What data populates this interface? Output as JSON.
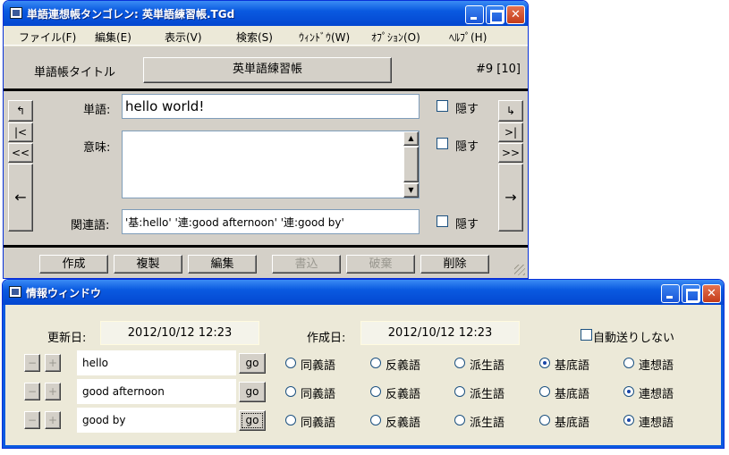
{
  "main_window": {
    "title": "単語連想帳タンゴレン: 英単語練習帳.TGd",
    "menu": [
      "ファイル(F)",
      "編集(E)",
      "表示(V)",
      "検索(S)",
      "ｳｨﾝﾄﾞｳ(W)",
      "ｵﾌﾟｼｮﾝ(O)",
      "ﾍﾙﾌﾟ(H)"
    ],
    "book_title_label": "単語帳タイトル",
    "book_title": "英単語練習帳",
    "counter": "#9 [10]",
    "word_label": "単語:",
    "word_value": "hello world!",
    "meaning_label": "意味:",
    "meaning_value": "",
    "related_label": "関連語:",
    "related_value": "'基:hello' '連:good afternoon' '連:good by'",
    "hide_label": "隠す",
    "nav_left": [
      "↰",
      "|<",
      "<<",
      "←"
    ],
    "nav_right": [
      "↳",
      ">|",
      ">>",
      "→"
    ],
    "buttons": [
      "作成",
      "複製",
      "編集",
      "書込",
      "破棄",
      "削除"
    ]
  },
  "info_window": {
    "title": "情報ウィンドウ",
    "updated_label": "更新日:",
    "updated_value": "2012/10/12 12:23",
    "created_label": "作成日:",
    "created_value": "2012/10/12 12:23",
    "auto_label": "自動送りしない",
    "go_label": "go",
    "minus": "−",
    "plus": "+",
    "radio_labels": [
      "同義語",
      "反義語",
      "派生語",
      "基底語",
      "連想語"
    ],
    "rows": [
      {
        "word": "hello",
        "selected": 3
      },
      {
        "word": "good afternoon",
        "selected": 4
      },
      {
        "word": "good by",
        "selected": 4
      }
    ]
  }
}
